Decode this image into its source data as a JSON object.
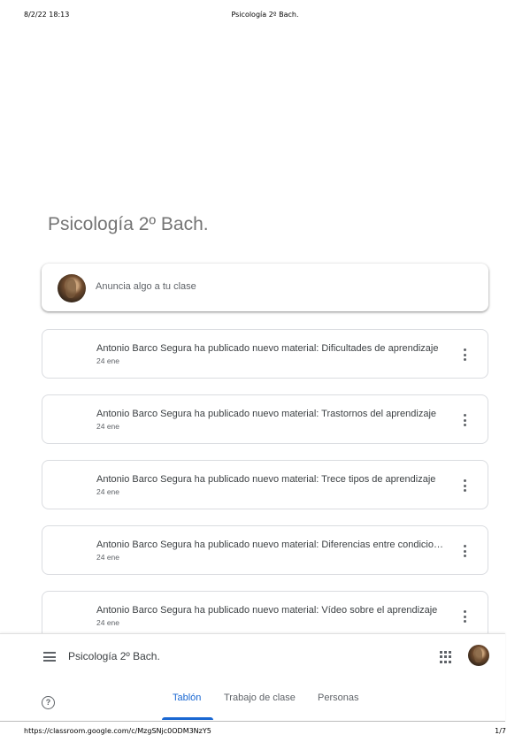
{
  "print_header": {
    "datetime": "8/2/22 18:13",
    "page_title": "Psicología 2º Bach."
  },
  "print_footer": {
    "url": "https://classroom.google.com/c/MzgSNjc0ODM3NzY5",
    "page_num": "1/7"
  },
  "class_title": "Psicología 2º Bach.",
  "announce": {
    "placeholder": "Anuncia algo a tu clase"
  },
  "posts": [
    {
      "title": "Antonio Barco Segura ha publicado nuevo material: Dificultades de aprendizaje",
      "date": "24 ene"
    },
    {
      "title": "Antonio Barco Segura ha publicado nuevo material: Trastornos del aprendizaje",
      "date": "24 ene"
    },
    {
      "title": "Antonio Barco Segura ha publicado nuevo material: Trece tipos de aprendizaje",
      "date": "24 ene"
    },
    {
      "title": "Antonio Barco Segura ha publicado nuevo material: Diferencias entre condicionamiento",
      "date": "24 ene"
    },
    {
      "title": "Antonio Barco Segura ha publicado nuevo material: Vídeo sobre el aprendizaje",
      "date": "24 ene"
    }
  ],
  "nav": {
    "title": "Psicología 2º Bach.",
    "tabs": [
      {
        "label": "Tablón",
        "active": true
      },
      {
        "label": "Trabajo de clase",
        "active": false
      },
      {
        "label": "Personas",
        "active": false
      }
    ]
  },
  "icons": {
    "menu": "hamburger-menu-icon",
    "apps": "apps-grid-icon",
    "help": "help-icon",
    "more": "more-vert-icon"
  },
  "colors": {
    "accent": "#1967d2",
    "title_gray": "#757575"
  }
}
